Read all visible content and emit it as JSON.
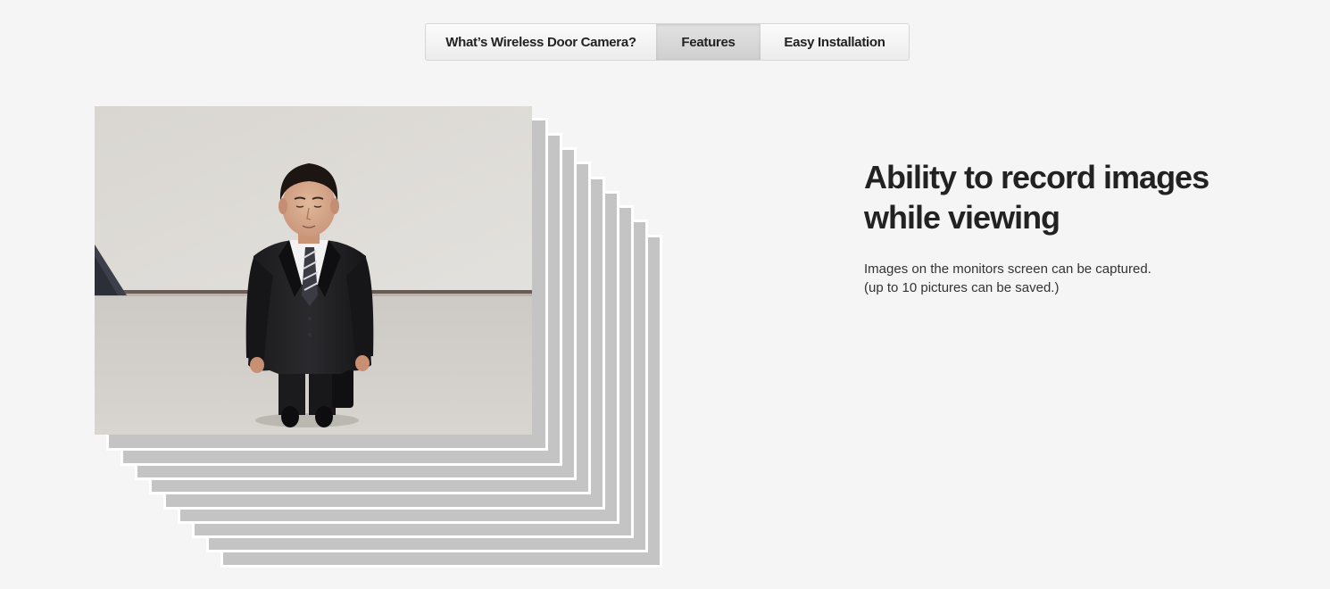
{
  "tabs": [
    {
      "label": "What’s Wireless Door Camera?",
      "active": false
    },
    {
      "label": "Features",
      "active": true
    },
    {
      "label": "Easy Installation",
      "active": false
    }
  ],
  "feature": {
    "heading_line1": "Ability to record images",
    "heading_line2": "while viewing",
    "description_line1": "Images on the monitors screen can be captured.",
    "description_line2": "(up to 10 pictures can be saved.)"
  },
  "stack": {
    "layers": 10
  },
  "colors": {
    "background": "#f5f5f5",
    "stack_gray": "#c4c4c4",
    "stack_border": "#ffffff",
    "text_dark": "#222222",
    "active_tab": "#d6d6d6"
  }
}
